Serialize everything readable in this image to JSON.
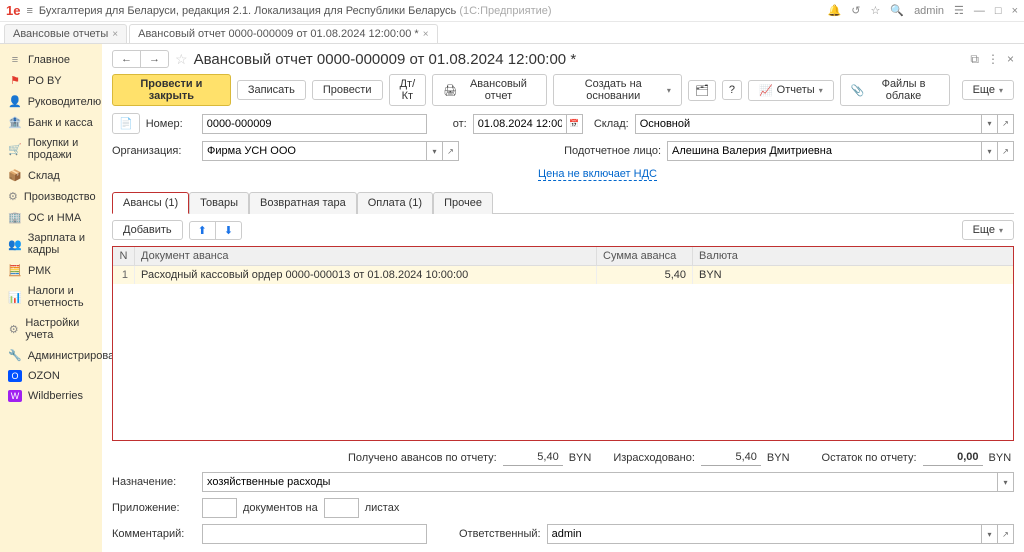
{
  "titlebar": {
    "logo": "1e",
    "app_title": "Бухгалтерия для Беларуси, редакция 2.1. Локализация для Республики Беларусь",
    "platform": "(1С:Предприятие)",
    "user": "admin"
  },
  "tabs": {
    "t1": "Авансовые отчеты",
    "t2": "Авансовый отчет 0000-000009 от 01.08.2024 12:00:00 *"
  },
  "nav": {
    "main": "Главное",
    "poby": "PO BY",
    "manager": "Руководителю",
    "bank": "Банк и касса",
    "sales": "Покупки и продажи",
    "sklad": "Склад",
    "proizv": "Производство",
    "osnma": "ОС и НМА",
    "zp": "Зарплата и кадры",
    "rmk": "РМК",
    "nalog": "Налоги и отчетность",
    "nastr": "Настройки учета",
    "admin": "Администрирование",
    "ozon": "OZON",
    "wb": "Wildberries"
  },
  "doc": {
    "title": "Авансовый отчет 0000-000009 от 01.08.2024 12:00:00 *",
    "btn_post_close": "Провести и закрыть",
    "btn_save": "Записать",
    "btn_post": "Провести",
    "btn_print": "Авансовый отчет",
    "btn_create_based": "Создать на основании",
    "btn_reports": "Отчеты",
    "btn_files": "Файлы в облаке",
    "btn_more": "Еще",
    "lbl_number": "Номер:",
    "number": "0000-000009",
    "lbl_from": "от:",
    "date": "01.08.2024 12:00:00",
    "lbl_sklad": "Склад:",
    "sklad": "Основной",
    "lbl_org": "Организация:",
    "org": "Фирма УСН ООО",
    "lbl_person": "Подотчетное лицо:",
    "person": "Алешина Валерия Дмитриевна",
    "price_link": "Цена не включает НДС"
  },
  "subtabs": {
    "avansy": "Авансы (1)",
    "tovary": "Товары",
    "tara": "Возвратная тара",
    "oplata": "Оплата (1)",
    "prochee": "Прочее"
  },
  "tabtoolbar": {
    "add": "Добавить",
    "more": "Еще"
  },
  "grid": {
    "h_n": "N",
    "h_doc": "Документ аванса",
    "h_sum": "Сумма аванса",
    "h_cur": "Валюта",
    "row_n": "1",
    "row_doc": "Расходный кассовый ордер 0000-000013 от 01.08.2024 10:00:00",
    "row_sum": "5,40",
    "row_cur": "BYN"
  },
  "totals": {
    "lbl_received": "Получено авансов по отчету:",
    "received": "5,40",
    "cur1": "BYN",
    "lbl_spent": "Израсходовано:",
    "spent": "5,40",
    "cur2": "BYN",
    "lbl_rest": "Остаток по отчету:",
    "rest": "0,00",
    "cur3": "BYN"
  },
  "footer": {
    "lbl_nazn": "Назначение:",
    "nazn": "хозяйственные расходы",
    "lbl_pril": "Приложение:",
    "docs_on": "документов на",
    "sheets": "листах",
    "lbl_comment": "Комментарий:",
    "lbl_resp": "Ответственный:",
    "resp": "admin"
  }
}
